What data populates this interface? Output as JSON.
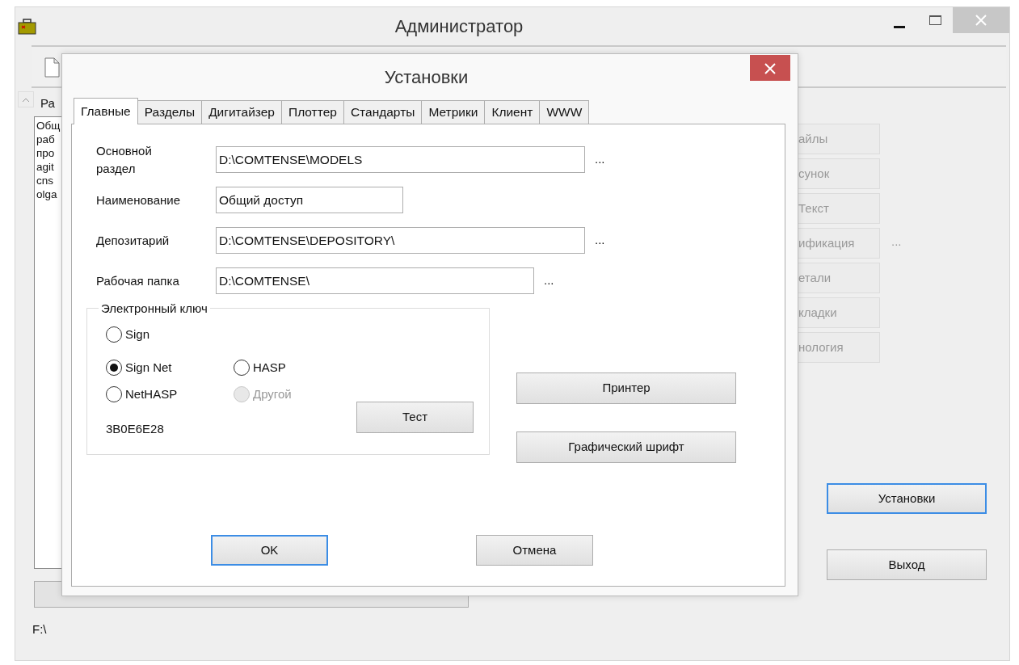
{
  "window": {
    "title": "Администратор"
  },
  "main": {
    "list_header": "Ра",
    "list_items": [
      "Общ",
      "раб",
      "про",
      "agit",
      "cns",
      "olga"
    ],
    "side_buttons": [
      {
        "label": "айлы",
        "more": false
      },
      {
        "label": "сунок",
        "more": false
      },
      {
        "label": "Текст",
        "more": false
      },
      {
        "label": "ификация",
        "more": true
      },
      {
        "label": "етали",
        "more": false
      },
      {
        "label": "кладки",
        "more": false
      },
      {
        "label": "нология",
        "more": false
      }
    ],
    "more_text": "...",
    "buttons": [
      {
        "label": "Установки",
        "focused": true
      },
      {
        "label": "Выход",
        "focused": false
      }
    ],
    "status": "F:\\"
  },
  "dialog": {
    "title": "Установки",
    "tabs": [
      {
        "label": "Главные",
        "selected": true
      },
      {
        "label": "Разделы",
        "selected": false
      },
      {
        "label": "Дигитайзер",
        "selected": false
      },
      {
        "label": "Плоттер",
        "selected": false
      },
      {
        "label": "Стандарты",
        "selected": false
      },
      {
        "label": "Метрики",
        "selected": false
      },
      {
        "label": "Клиент",
        "selected": false
      },
      {
        "label": "WWW",
        "selected": false
      }
    ],
    "fields": [
      {
        "label": "Основной\nраздел",
        "value": "D:\\COMTENSE\\MODELS",
        "browse": "..."
      },
      {
        "label": "Наименование",
        "value": "Общий доступ"
      },
      {
        "label": "Депозитарий",
        "value": "D:\\COMTENSE\\DEPOSITORY\\",
        "browse": "..."
      },
      {
        "label": "Рабочая папка",
        "value": "D:\\COMTENSE\\",
        "browse": "..."
      }
    ],
    "key_group": {
      "title": "Электронный ключ",
      "options": [
        {
          "label": "Sign",
          "selected": false,
          "disabled": false
        },
        {
          "label": "Sign Net",
          "selected": true,
          "disabled": false
        },
        {
          "label": "HASP",
          "selected": false,
          "disabled": false
        },
        {
          "label": "NetHASP",
          "selected": false,
          "disabled": false
        },
        {
          "label": "Другой",
          "selected": false,
          "disabled": true
        }
      ],
      "code": "3B0E6E28",
      "test_button": "Тест"
    },
    "side_buttons": [
      "Принтер",
      "Графический шрифт"
    ],
    "buttons": [
      {
        "label": "OK",
        "focused": true
      },
      {
        "label": "Отмена",
        "focused": false
      }
    ]
  }
}
